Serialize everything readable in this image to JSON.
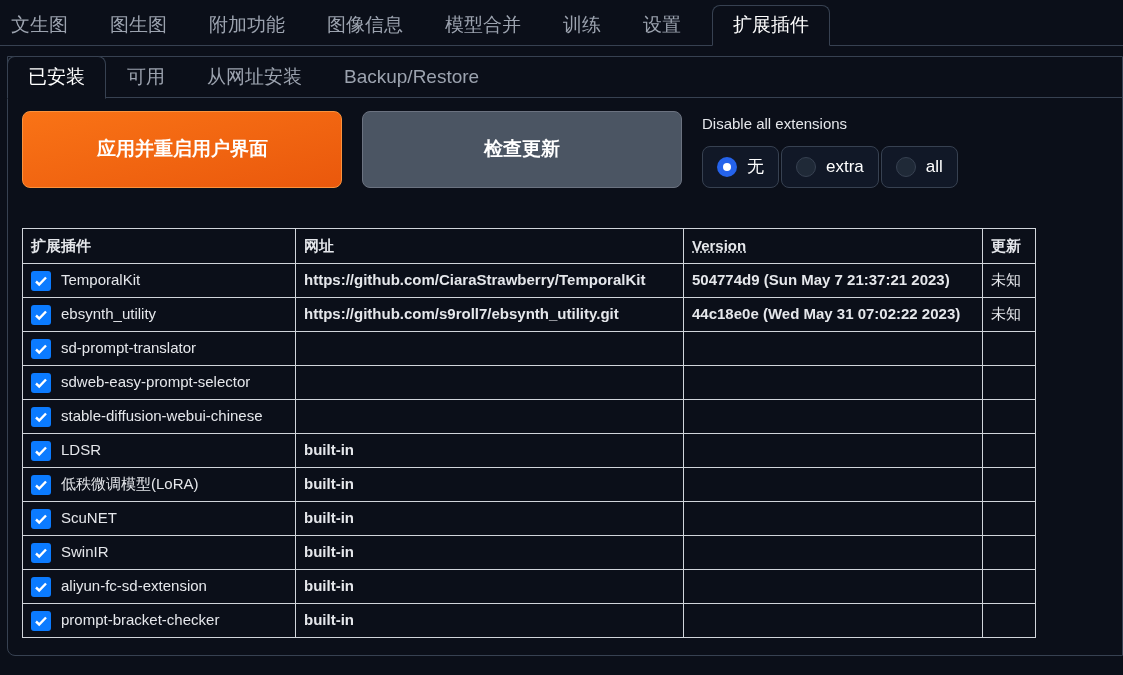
{
  "top_tabs": [
    {
      "label": "文生图",
      "selected": false
    },
    {
      "label": "图生图",
      "selected": false
    },
    {
      "label": "附加功能",
      "selected": false
    },
    {
      "label": "图像信息",
      "selected": false
    },
    {
      "label": "模型合并",
      "selected": false
    },
    {
      "label": "训练",
      "selected": false
    },
    {
      "label": "设置",
      "selected": false
    },
    {
      "label": "扩展插件",
      "selected": true
    }
  ],
  "sub_tabs": [
    {
      "label": "已安装",
      "selected": true
    },
    {
      "label": "可用",
      "selected": false
    },
    {
      "label": "从网址安装",
      "selected": false
    },
    {
      "label": "Backup/Restore",
      "selected": false
    }
  ],
  "buttons": [
    {
      "label": "应用并重启用户界面",
      "kind": "primary"
    },
    {
      "label": "检查更新",
      "kind": "secondary"
    }
  ],
  "disable_all": {
    "label": "Disable all extensions",
    "options": [
      {
        "label": "无",
        "selected": true
      },
      {
        "label": "extra",
        "selected": false
      },
      {
        "label": "all",
        "selected": false
      }
    ]
  },
  "table": {
    "columns": [
      {
        "label": "扩展插件",
        "kind": "plain"
      },
      {
        "label": "网址",
        "kind": "plain"
      },
      {
        "label": "Version",
        "kind": "abbr"
      },
      {
        "label": "更新",
        "kind": "plain"
      }
    ],
    "rows": [
      {
        "enabled": true,
        "name": "TemporalKit",
        "url": "https://github.com/CiaraStrawberry/TemporalKit",
        "version": "504774d9 (Sun May 7 21:37:21 2023)",
        "update": "未知"
      },
      {
        "enabled": true,
        "name": "ebsynth_utility",
        "url": "https://github.com/s9roll7/ebsynth_utility.git",
        "version": "44c18e0e (Wed May 31 07:02:22 2023)",
        "update": "未知"
      },
      {
        "enabled": true,
        "name": "sd-prompt-translator"
      },
      {
        "enabled": true,
        "name": "sdweb-easy-prompt-selector"
      },
      {
        "enabled": true,
        "name": "stable-diffusion-webui-chinese"
      },
      {
        "enabled": true,
        "name": "LDSR",
        "url": "built-in"
      },
      {
        "enabled": true,
        "name": "低秩微调模型(LoRA)",
        "url": "built-in"
      },
      {
        "enabled": true,
        "name": "ScuNET",
        "url": "built-in"
      },
      {
        "enabled": true,
        "name": "SwinIR",
        "url": "built-in"
      },
      {
        "enabled": true,
        "name": "aliyun-fc-sd-extension",
        "url": "built-in"
      },
      {
        "enabled": true,
        "name": "prompt-bracket-checker",
        "url": "built-in"
      }
    ]
  }
}
